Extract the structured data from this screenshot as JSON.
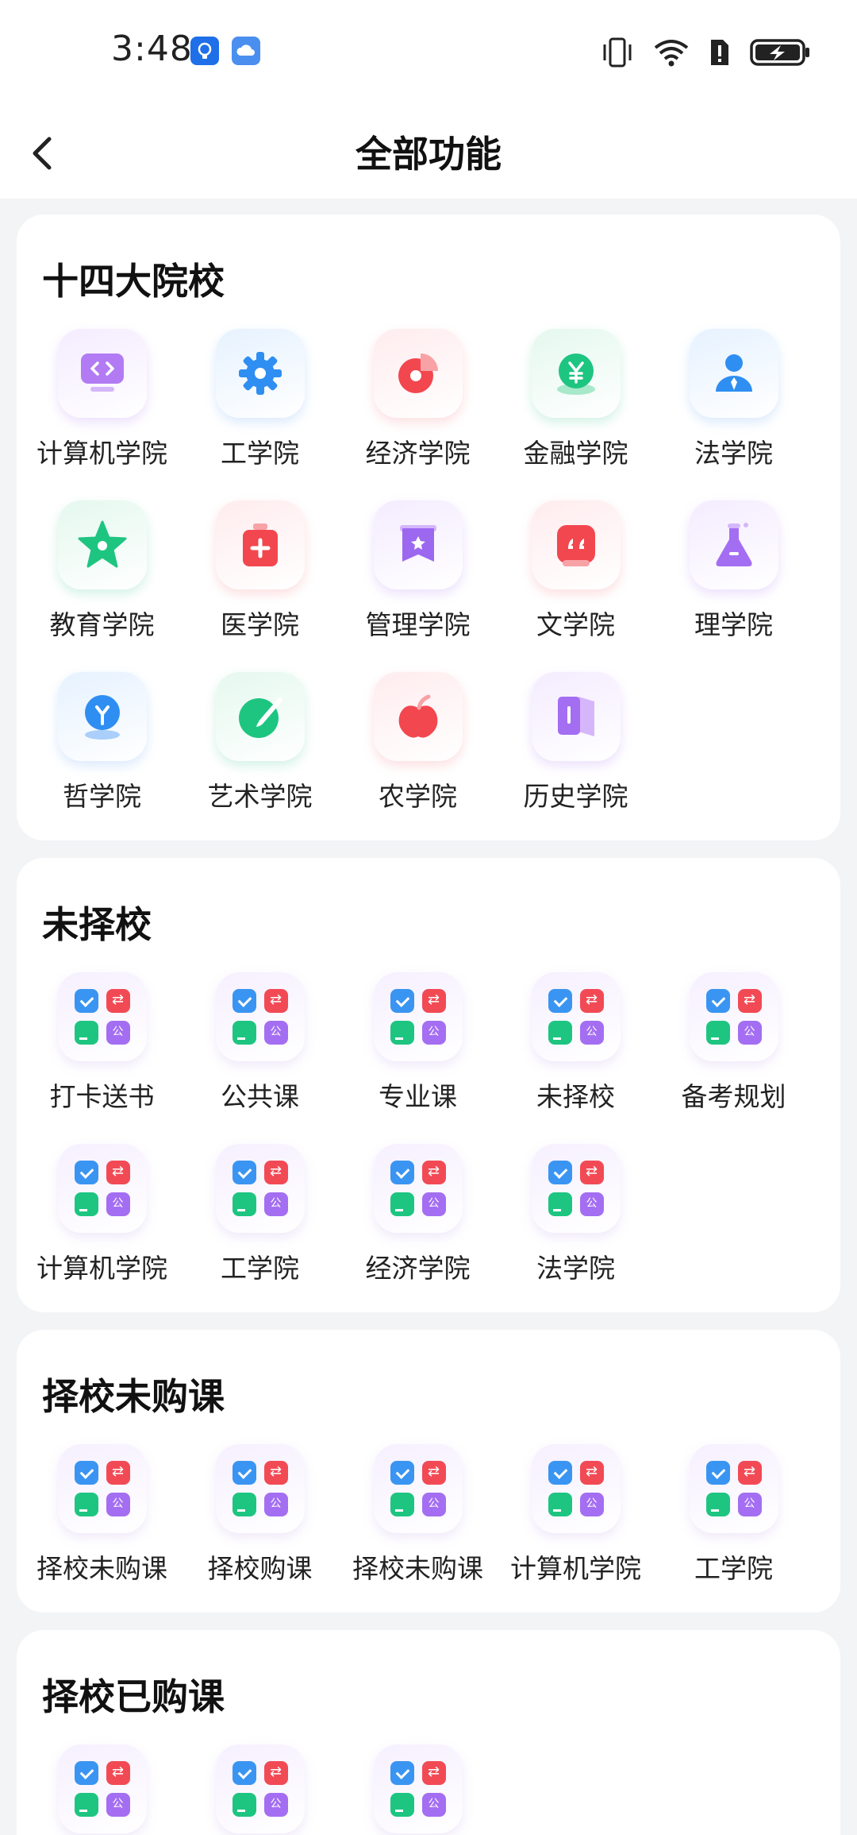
{
  "status_bar": {
    "time": "3:48",
    "icons": [
      "bulb-notification-icon",
      "cloud-notification-icon",
      "vibrate-icon",
      "wifi-icon",
      "sim-alert-icon",
      "battery-charging-icon"
    ]
  },
  "header": {
    "title": "全部功能",
    "back_icon": "chevron-left-icon"
  },
  "sections": [
    {
      "title": "十四大院校",
      "items": [
        {
          "label": "计算机学院",
          "icon": "computer-code-icon"
        },
        {
          "label": "工学院",
          "icon": "gear-icon"
        },
        {
          "label": "经济学院",
          "icon": "pie-chart-icon"
        },
        {
          "label": "金融学院",
          "icon": "yuan-coin-icon"
        },
        {
          "label": "法学院",
          "icon": "person-icon"
        },
        {
          "label": "教育学院",
          "icon": "star-icon"
        },
        {
          "label": "医学院",
          "icon": "medical-kit-icon"
        },
        {
          "label": "管理学院",
          "icon": "banner-star-icon"
        },
        {
          "label": "文学院",
          "icon": "quote-icon"
        },
        {
          "label": "理学院",
          "icon": "flask-icon"
        },
        {
          "label": "哲学院",
          "icon": "lightbulb-icon"
        },
        {
          "label": "艺术学院",
          "icon": "palette-icon"
        },
        {
          "label": "农学院",
          "icon": "apple-icon"
        },
        {
          "label": "历史学院",
          "icon": "book-icon"
        }
      ]
    },
    {
      "title": "未择校",
      "items": [
        {
          "label": "打卡送书",
          "icon": "app-grid-icon"
        },
        {
          "label": "公共课",
          "icon": "app-grid-icon"
        },
        {
          "label": "专业课",
          "icon": "app-grid-icon"
        },
        {
          "label": "未择校",
          "icon": "app-grid-icon"
        },
        {
          "label": "备考规划",
          "icon": "app-grid-icon"
        },
        {
          "label": "计算机学院",
          "icon": "app-grid-icon"
        },
        {
          "label": "工学院",
          "icon": "app-grid-icon"
        },
        {
          "label": "经济学院",
          "icon": "app-grid-icon"
        },
        {
          "label": "法学院",
          "icon": "app-grid-icon"
        }
      ]
    },
    {
      "title": "择校未购课",
      "items": [
        {
          "label": "择校未购课",
          "icon": "app-grid-icon"
        },
        {
          "label": "择校购课",
          "icon": "app-grid-icon"
        },
        {
          "label": "择校未购课",
          "icon": "app-grid-icon"
        },
        {
          "label": "计算机学院",
          "icon": "app-grid-icon"
        },
        {
          "label": "工学院",
          "icon": "app-grid-icon"
        }
      ]
    },
    {
      "title": "择校已购课",
      "items": [
        {
          "label": "",
          "icon": "app-grid-icon"
        },
        {
          "label": "",
          "icon": "app-grid-icon"
        },
        {
          "label": "",
          "icon": "app-grid-icon"
        }
      ]
    }
  ]
}
